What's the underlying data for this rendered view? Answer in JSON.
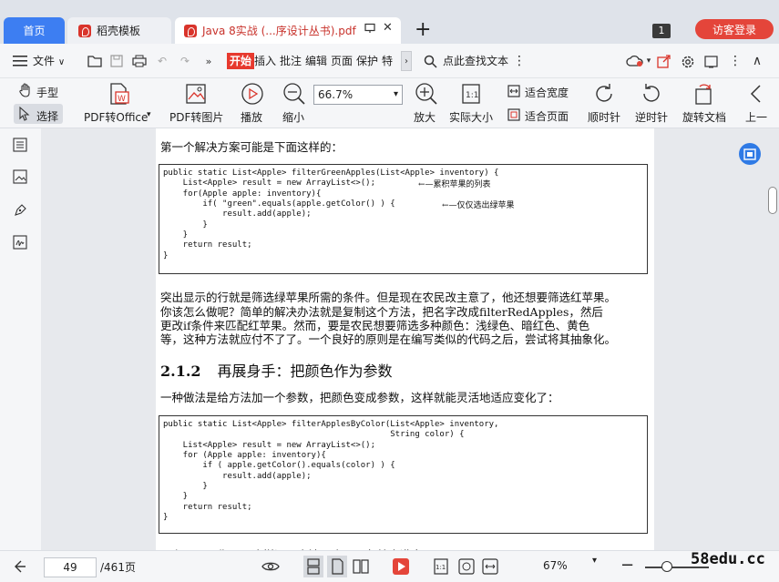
{
  "tabs": {
    "home": "首页",
    "template": "稻壳模板",
    "pdf": "Java 8实战 (...序设计丛书).pdf",
    "count": "1",
    "login": "访客登录"
  },
  "menu": {
    "file": "文件",
    "start": "开始",
    "insert": "插入",
    "annotate": "批注",
    "edit": "编辑",
    "page": "页面",
    "protect": "保护",
    "special": "特色",
    "search": "点此查找文本"
  },
  "ribbon": {
    "hand": "手型",
    "select": "选择",
    "pdf_office": "PDF转Office",
    "pdf_image": "PDF转图片",
    "play": "播放",
    "zoom_out": "缩小",
    "zoom_value": "66.7%",
    "zoom_in": "放大",
    "actual_size": "实际大小",
    "fit_width": "适合宽度",
    "fit_page": "适合页面",
    "rotate_cw": "顺时针",
    "rotate_ccw": "逆时针",
    "rotate_doc": "旋转文档",
    "prev": "上一"
  },
  "document": {
    "para1": "第一个解决方案可能是下面这样的：",
    "code1": [
      "public static List<Apple> filterGreenApples(List<Apple> inventory) {",
      "    List<Apple> result = new ArrayList<>();",
      "    for(Apple apple: inventory){",
      "        if( \"green\".equals(apple.getColor() ) {",
      "            result.add(apple);",
      "        }",
      "    }",
      "    return result;",
      "}"
    ],
    "ann1": "←—累积苹果的列表",
    "ann2": "←—仅仅选出绿苹果",
    "para2": [
      "突出显示的行就是筛选绿苹果所需的条件。但是现在农民改主意了，他还想要筛选红苹果。",
      "你该怎么做呢？简单的解决办法就是复制这个方法，把名字改成filterRedApples，然后",
      "更改if条件来匹配红苹果。然而，要是农民想要筛选多种颜色：浅绿色、暗红色、黄色",
      "等，这种方法就应付不了了。一个良好的原则是在编写类似的代码之后，尝试将其抽象化。"
    ],
    "section_num": "2.1.2",
    "section_title": "再展身手：把颜色作为参数",
    "para3": "一种做法是给方法加一个参数，把颜色变成参数，这样就能灵活地适应变化了：",
    "code2": [
      "public static List<Apple> filterApplesByColor(List<Apple> inventory,",
      "                                              String color) {",
      "    List<Apple> result = new ArrayList<>();",
      "    for (Apple apple: inventory){",
      "        if ( apple.getColor().equals(color) ) {",
      "            result.add(apple);",
      "        }",
      "    }",
      "    return result;",
      "}"
    ],
    "cut_line": "现在，只要像下面这样调用方法，农民朋友就会满意了："
  },
  "status": {
    "page_current": "49",
    "page_total": "/461页",
    "zoom": "67%",
    "watermark": "58edu.cc"
  }
}
